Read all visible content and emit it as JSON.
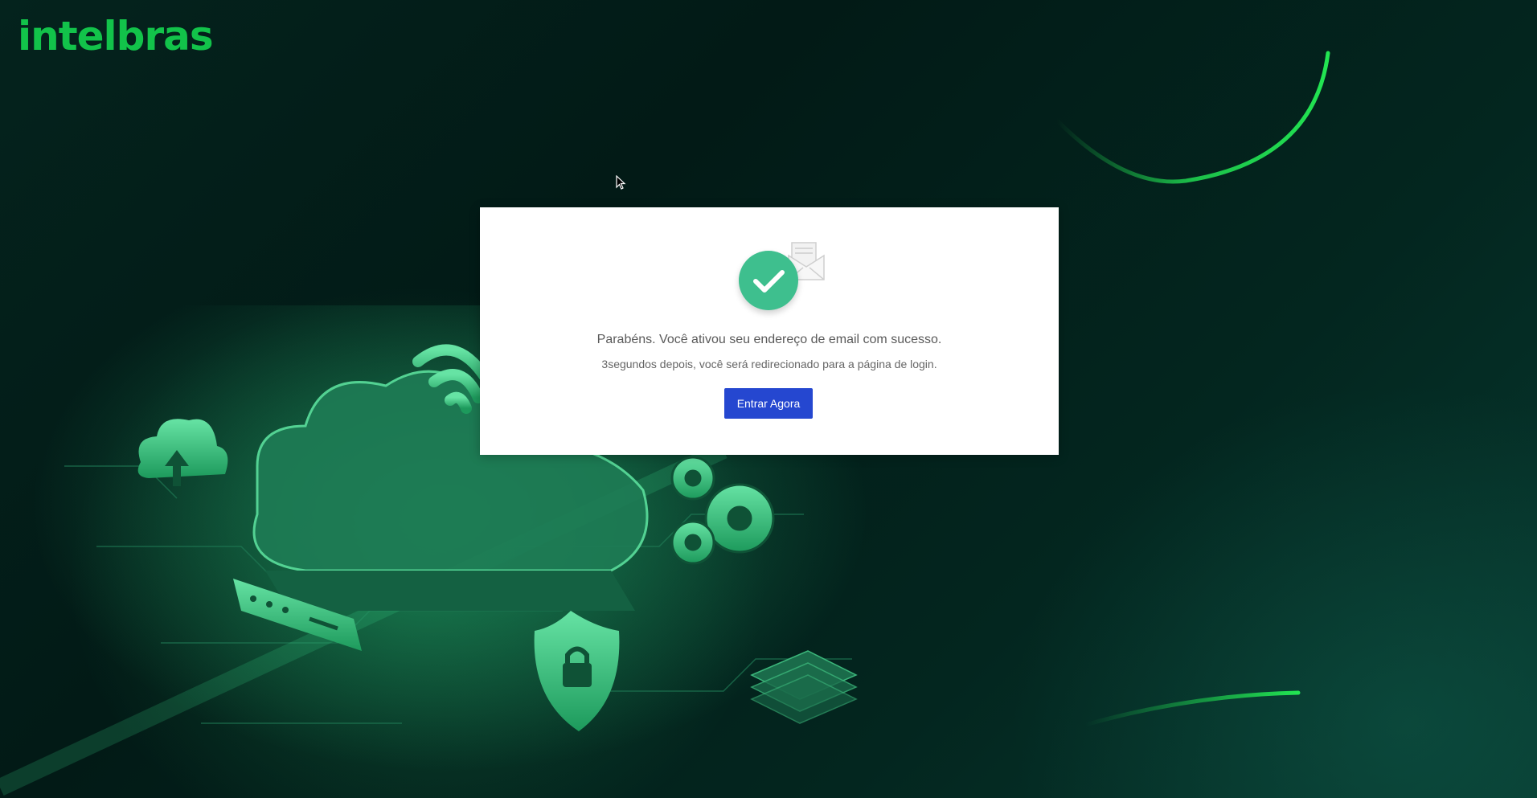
{
  "brand": {
    "logo_text": "intelbras",
    "color": "#12c34a"
  },
  "modal": {
    "icon": "success-check-icon",
    "title": "Parabéns. Você ativou seu endereço de email com sucesso.",
    "subtitle": "3segundos depois, você será redirecionado para a página de login.",
    "button_label": "Entrar Agora",
    "button_color": "#2547d0",
    "check_color": "#3ebf8e"
  },
  "theme": {
    "background": "#021a16",
    "accent": "#1fd14f"
  }
}
